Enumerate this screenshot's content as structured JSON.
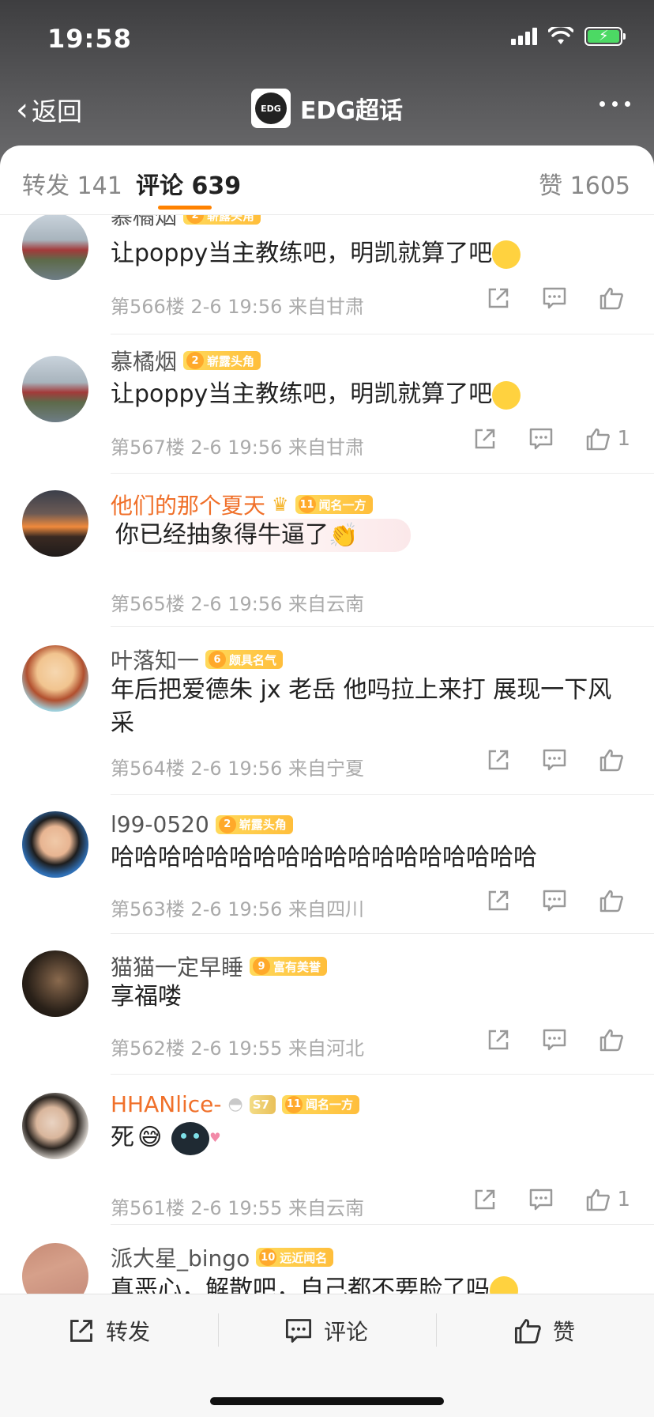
{
  "status": {
    "time": "19:58"
  },
  "nav": {
    "back_label": "返回",
    "title": "EDG超话",
    "logo_text": "EDG"
  },
  "tabs": {
    "repost": "转发 141",
    "comments": "评论 639",
    "likes": "赞 1605"
  },
  "comments": [
    {
      "user": "慕橘烟",
      "badge_level": "2",
      "badge_text": "崭露头角",
      "text": "让poppy当主教练吧，明凯就算了吧",
      "emoji": "meh-emoji",
      "meta": "第566楼 2-6 19:56 来自甘肃",
      "likes": ""
    },
    {
      "user": "慕橘烟",
      "badge_level": "2",
      "badge_text": "崭露头角",
      "text": "让poppy当主教练吧，明凯就算了吧",
      "emoji": "meh-emoji",
      "meta": "第567楼 2-6 19:56 来自甘肃",
      "likes": "1"
    },
    {
      "user": "他们的那个夏天",
      "badge_level": "11",
      "badge_text": "闻名一方",
      "text": "你已经抽象得牛逼了",
      "emoji": "clap-emoji",
      "meta": "第565楼 2-6 19:56 来自云南",
      "likes": ""
    },
    {
      "user": "叶落知一",
      "badge_level": "6",
      "badge_text": "颇具名气",
      "text": "年后把爱德朱  jx 老岳 他吗拉上来打 展现一下风采",
      "meta": "第564楼 2-6 19:56 来自宁夏",
      "likes": ""
    },
    {
      "user": "l99-0520",
      "badge_level": "2",
      "badge_text": "崭露头角",
      "text": "哈哈哈哈哈哈哈哈哈哈哈哈哈哈哈哈哈哈",
      "meta": "第563楼 2-6 19:56 来自四川",
      "likes": ""
    },
    {
      "user": "猫猫一定早睡",
      "badge_level": "9",
      "badge_text": "富有美誉",
      "text": "享福喽",
      "meta": "第562楼 2-6 19:55 来自河北",
      "likes": ""
    },
    {
      "user": "HHANlice-",
      "badge_level": "11",
      "badge_text": "闻名一方",
      "s7": "S7",
      "text": "死",
      "meta": "第561楼 2-6 19:55 来自云南",
      "likes": "1"
    },
    {
      "user": "派大星_bingo",
      "badge_level": "10",
      "badge_text": "远近闻名",
      "text": "真恶心，解散吧，自己都不要脸了吗",
      "meta": "",
      "likes": ""
    }
  ],
  "bottom": {
    "repost": "转发",
    "comment": "评论",
    "like": "赞"
  },
  "colors": {
    "accent": "#ff8200",
    "vip_name": "#f0702a",
    "badge": "#ffbe3b"
  }
}
